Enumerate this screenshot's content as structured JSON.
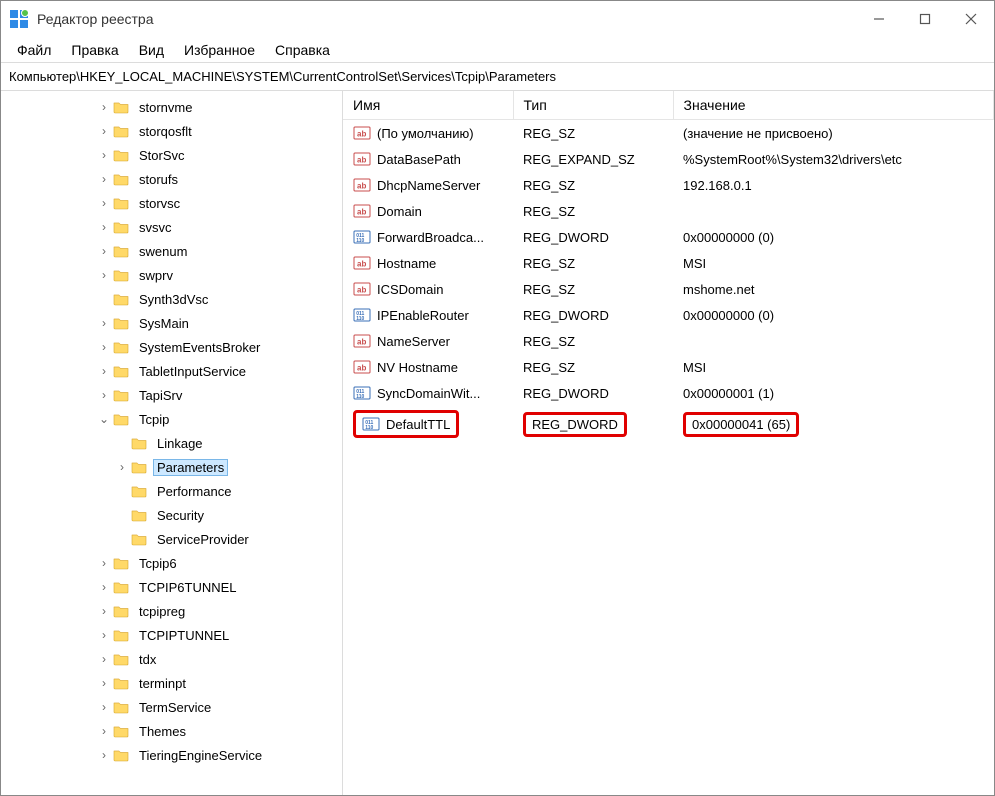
{
  "title": "Редактор реестра",
  "menu": [
    "Файл",
    "Правка",
    "Вид",
    "Избранное",
    "Справка"
  ],
  "address": "Компьютер\\HKEY_LOCAL_MACHINE\\SYSTEM\\CurrentControlSet\\Services\\Tcpip\\Parameters",
  "columns": {
    "name": "Имя",
    "type": "Тип",
    "value": "Значение"
  },
  "tree": [
    {
      "label": "stornvme",
      "depth": 5,
      "chev": ">"
    },
    {
      "label": "storqosflt",
      "depth": 5,
      "chev": ">"
    },
    {
      "label": "StorSvc",
      "depth": 5,
      "chev": ">"
    },
    {
      "label": "storufs",
      "depth": 5,
      "chev": ">"
    },
    {
      "label": "storvsc",
      "depth": 5,
      "chev": ">"
    },
    {
      "label": "svsvc",
      "depth": 5,
      "chev": ">"
    },
    {
      "label": "swenum",
      "depth": 5,
      "chev": ">"
    },
    {
      "label": "swprv",
      "depth": 5,
      "chev": ">"
    },
    {
      "label": "Synth3dVsc",
      "depth": 5,
      "chev": ""
    },
    {
      "label": "SysMain",
      "depth": 5,
      "chev": ">"
    },
    {
      "label": "SystemEventsBroker",
      "depth": 5,
      "chev": ">"
    },
    {
      "label": "TabletInputService",
      "depth": 5,
      "chev": ">"
    },
    {
      "label": "TapiSrv",
      "depth": 5,
      "chev": ">"
    },
    {
      "label": "Tcpip",
      "depth": 5,
      "chev": "v"
    },
    {
      "label": "Linkage",
      "depth": 6,
      "chev": ""
    },
    {
      "label": "Parameters",
      "depth": 6,
      "chev": ">",
      "selected": true
    },
    {
      "label": "Performance",
      "depth": 6,
      "chev": ""
    },
    {
      "label": "Security",
      "depth": 6,
      "chev": ""
    },
    {
      "label": "ServiceProvider",
      "depth": 6,
      "chev": ""
    },
    {
      "label": "Tcpip6",
      "depth": 5,
      "chev": ">"
    },
    {
      "label": "TCPIP6TUNNEL",
      "depth": 5,
      "chev": ">"
    },
    {
      "label": "tcpipreg",
      "depth": 5,
      "chev": ">"
    },
    {
      "label": "TCPIPTUNNEL",
      "depth": 5,
      "chev": ">"
    },
    {
      "label": "tdx",
      "depth": 5,
      "chev": ">"
    },
    {
      "label": "terminpt",
      "depth": 5,
      "chev": ">"
    },
    {
      "label": "TermService",
      "depth": 5,
      "chev": ">"
    },
    {
      "label": "Themes",
      "depth": 5,
      "chev": ">"
    },
    {
      "label": "TieringEngineService",
      "depth": 5,
      "chev": ">"
    }
  ],
  "values": [
    {
      "icon": "sz",
      "name": "(По умолчанию)",
      "type": "REG_SZ",
      "value": "(значение не присвоено)"
    },
    {
      "icon": "sz",
      "name": "DataBasePath",
      "type": "REG_EXPAND_SZ",
      "value": "%SystemRoot%\\System32\\drivers\\etc"
    },
    {
      "icon": "sz",
      "name": "DhcpNameServer",
      "type": "REG_SZ",
      "value": "192.168.0.1"
    },
    {
      "icon": "sz",
      "name": "Domain",
      "type": "REG_SZ",
      "value": ""
    },
    {
      "icon": "dw",
      "name": "ForwardBroadca...",
      "type": "REG_DWORD",
      "value": "0x00000000 (0)"
    },
    {
      "icon": "sz",
      "name": "Hostname",
      "type": "REG_SZ",
      "value": "MSI"
    },
    {
      "icon": "sz",
      "name": "ICSDomain",
      "type": "REG_SZ",
      "value": "mshome.net"
    },
    {
      "icon": "dw",
      "name": "IPEnableRouter",
      "type": "REG_DWORD",
      "value": "0x00000000 (0)"
    },
    {
      "icon": "sz",
      "name": "NameServer",
      "type": "REG_SZ",
      "value": ""
    },
    {
      "icon": "sz",
      "name": "NV Hostname",
      "type": "REG_SZ",
      "value": "MSI"
    },
    {
      "icon": "dw",
      "name": "SyncDomainWit...",
      "type": "REG_DWORD",
      "value": "0x00000001 (1)"
    },
    {
      "icon": "dw",
      "name": "DefaultTTL",
      "type": "REG_DWORD",
      "value": "0x00000041 (65)",
      "highlight": true
    }
  ]
}
